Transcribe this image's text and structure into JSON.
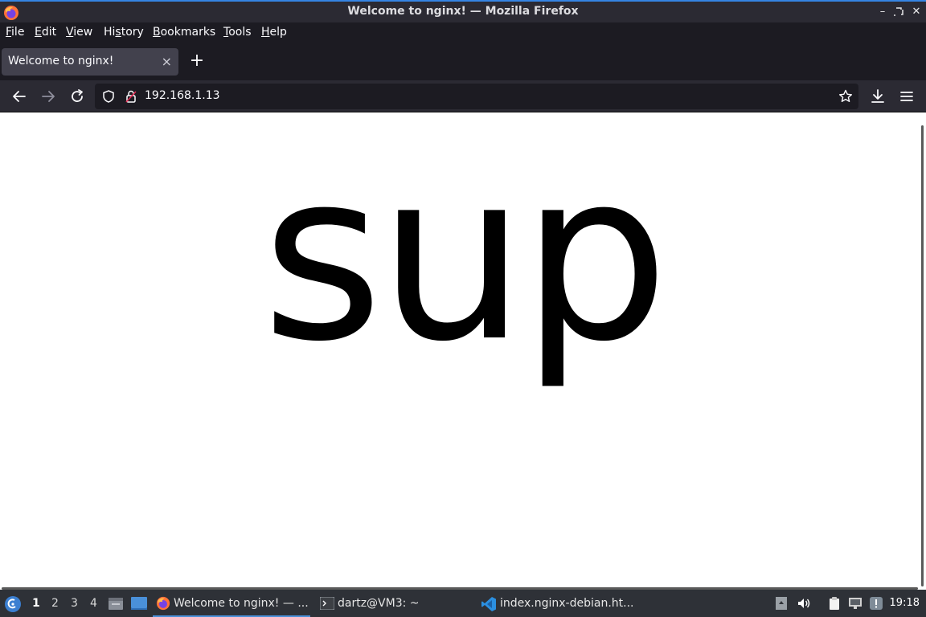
{
  "window": {
    "title": "Welcome to nginx! — Mozilla Firefox"
  },
  "menubar": {
    "items": [
      {
        "label": "File",
        "accel": "F",
        "rest": "ile"
      },
      {
        "label": "Edit",
        "accel": "E",
        "rest": "dit"
      },
      {
        "label": "View",
        "accel": "V",
        "rest": "iew"
      },
      {
        "label": "History",
        "pre": "Hi",
        "accel": "s",
        "rest": "tory"
      },
      {
        "label": "Bookmarks",
        "accel": "B",
        "rest": "ookmarks"
      },
      {
        "label": "Tools",
        "accel": "T",
        "rest": "ools"
      },
      {
        "label": "Help",
        "accel": "H",
        "rest": "elp"
      }
    ]
  },
  "tabs": [
    {
      "title": "Welcome to nginx!",
      "close": "×"
    }
  ],
  "newtab": {
    "label": "+"
  },
  "navbar": {
    "url": "192.168.1.13"
  },
  "page": {
    "text": "sup"
  },
  "taskbar": {
    "workspaces": [
      "1",
      "2",
      "3",
      "4"
    ],
    "active_workspace": "1",
    "tasks": [
      {
        "label": "Welcome to nginx! — ...",
        "icon": "firefox-icon",
        "active": true
      },
      {
        "label": "dartz@VM3: ~",
        "icon": "terminal-icon",
        "active": false
      },
      {
        "label": "index.nginx-debian.ht...",
        "icon": "vscode-icon",
        "active": false
      }
    ],
    "clock": "19:18"
  },
  "colors": {
    "titlebar_accent": "#3584e4",
    "toolbar_bg": "#2b2a33",
    "tab_active_bg": "#42414d",
    "page_bg": "#ffffff",
    "taskbar_bg": "#2e3137"
  }
}
